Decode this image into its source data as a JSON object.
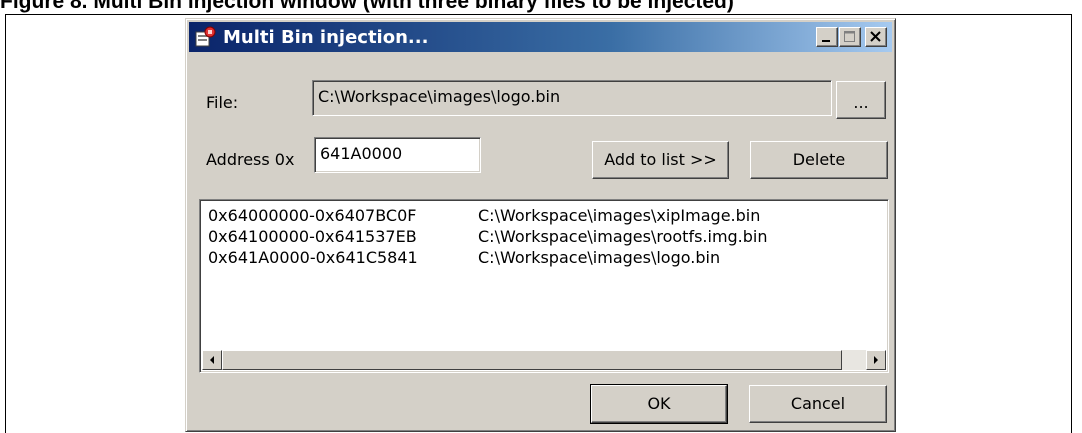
{
  "caption": "Figure 8. Multi Bin injection window (with three binary files to be injected)",
  "dialog": {
    "title": "Multi Bin injection...",
    "buttons": {
      "minimize": "minimize",
      "maximize": "maximize",
      "close": "close"
    }
  },
  "file": {
    "label": "File:",
    "value": "C:\\Workspace\\images\\logo.bin",
    "browse_label": "..."
  },
  "address": {
    "label": "Address 0x",
    "value": "641A0000",
    "add_label": "Add to list >>",
    "delete_label": "Delete"
  },
  "list": [
    {
      "range": "0x64000000-0x6407BC0F",
      "path": "C:\\Workspace\\images\\xipImage.bin"
    },
    {
      "range": "0x64100000-0x641537EB",
      "path": "C:\\Workspace\\images\\rootfs.img.bin"
    },
    {
      "range": "0x641A0000-0x641C5841",
      "path": "C:\\Workspace\\images\\logo.bin"
    }
  ],
  "footer": {
    "ok_label": "OK",
    "cancel_label": "Cancel"
  },
  "colors": {
    "face": "#d4d0c8",
    "title_start": "#0a246a",
    "title_end": "#a6caf0"
  },
  "icons": [
    "app-icon",
    "minimize-icon",
    "maximize-icon",
    "close-icon",
    "scroll-left-icon",
    "scroll-right-icon"
  ]
}
